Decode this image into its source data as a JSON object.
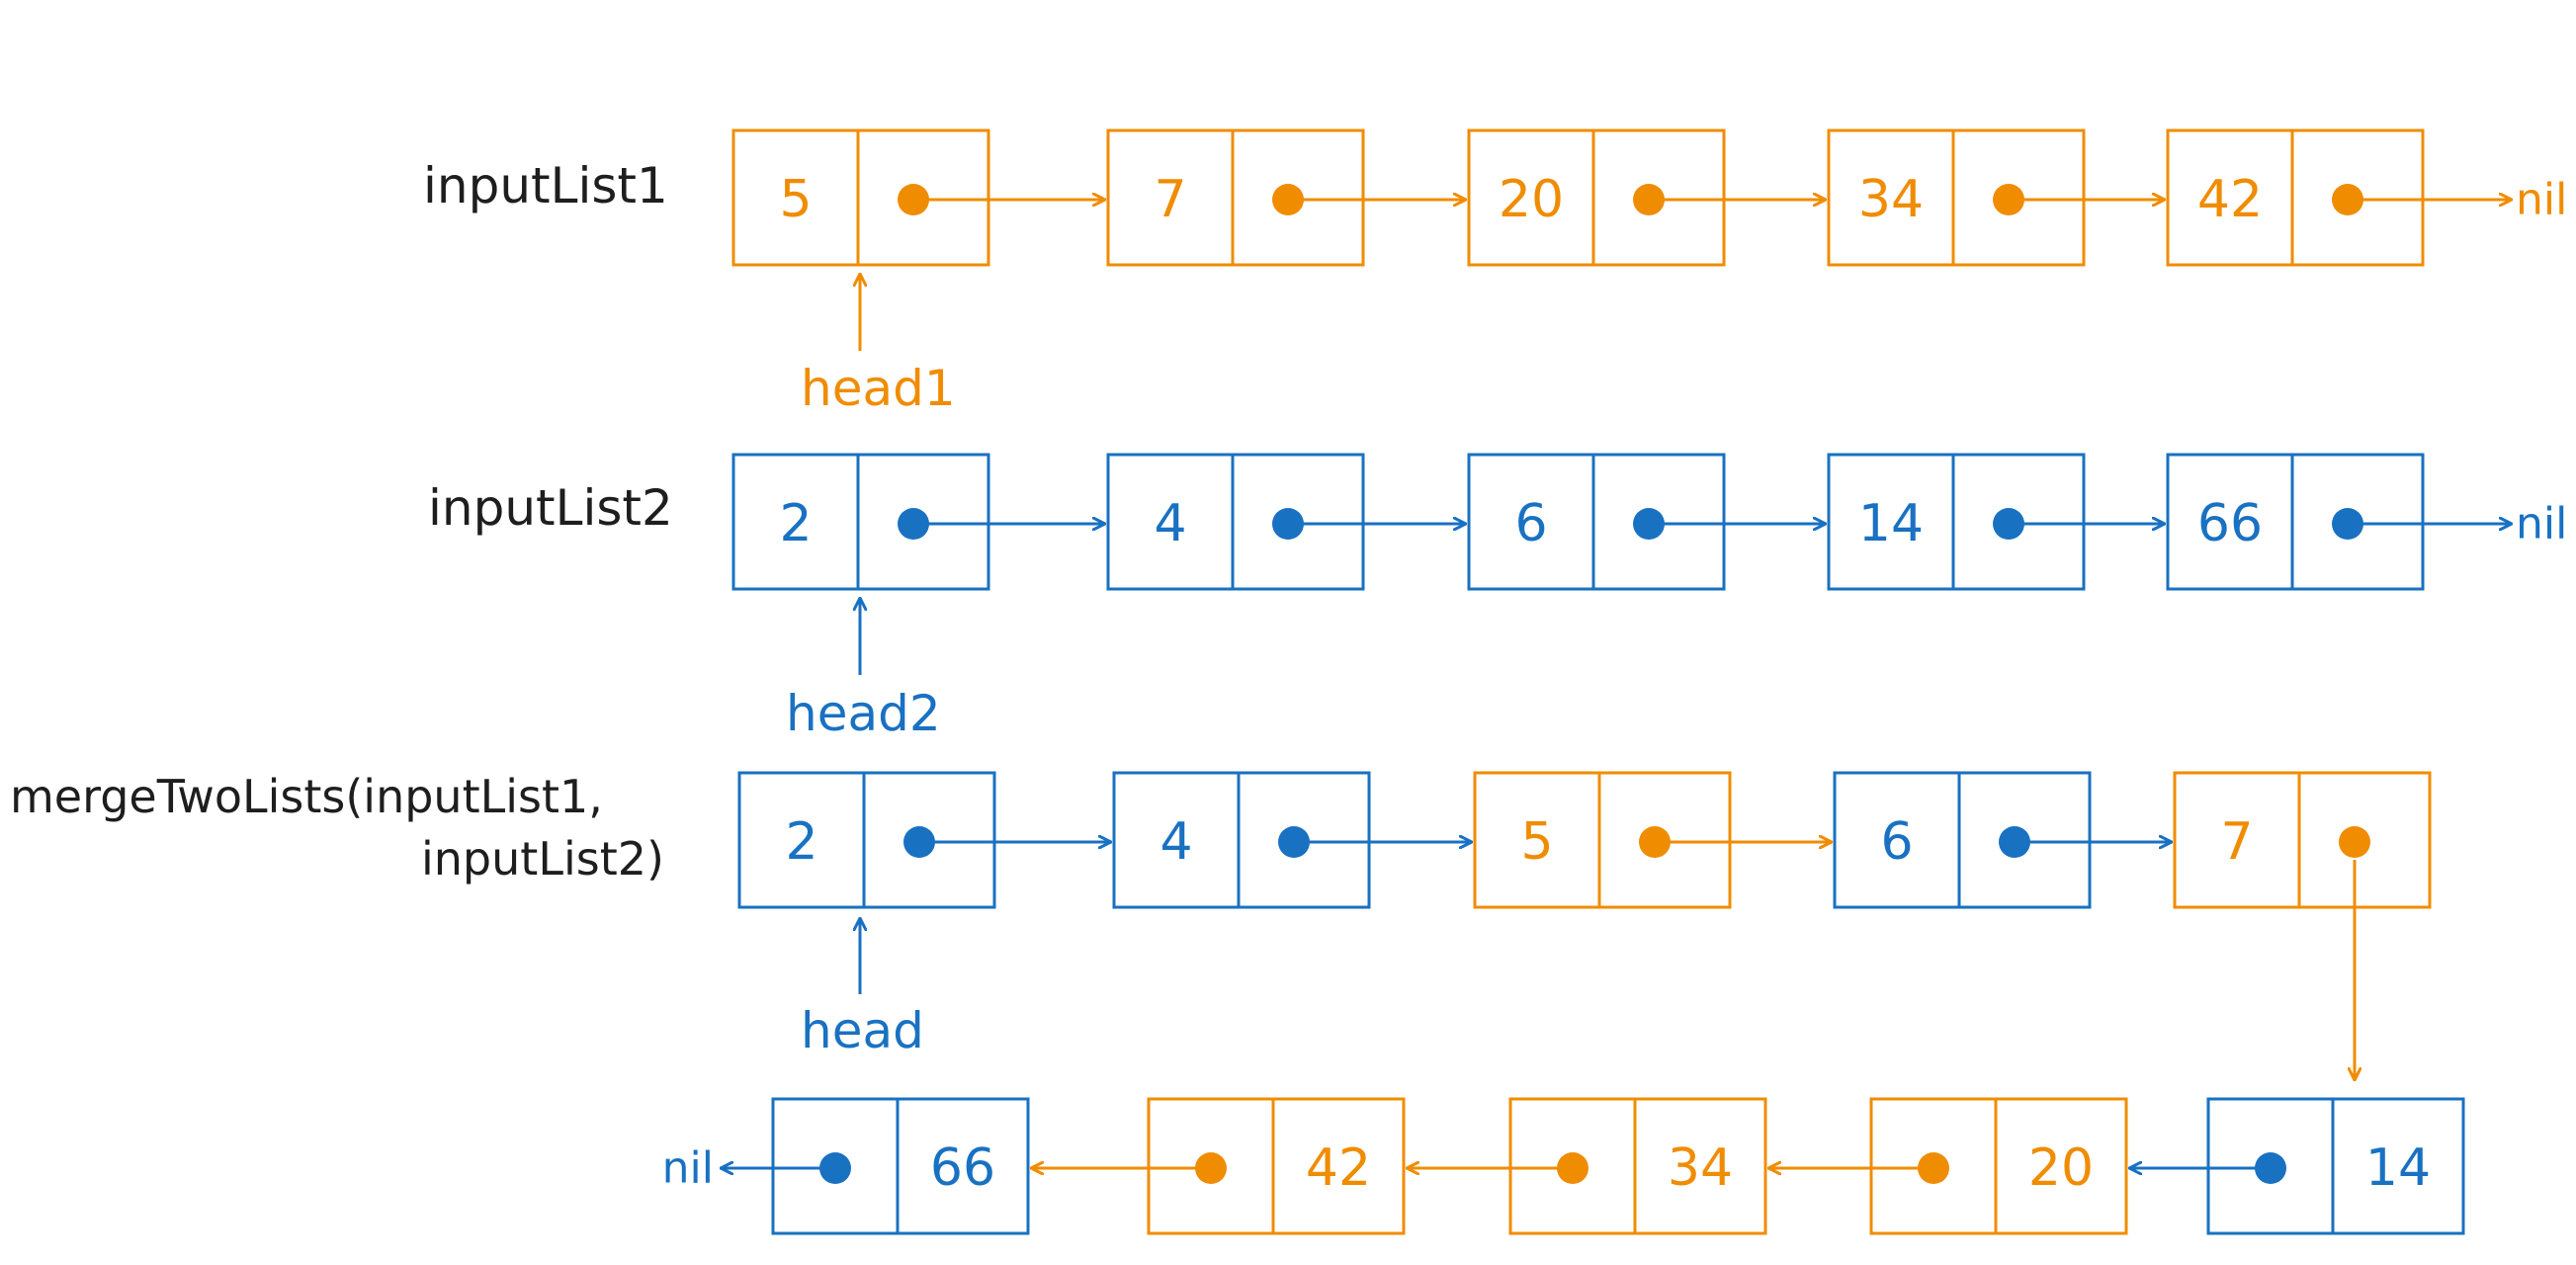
{
  "colors": {
    "orange": "#f08c00",
    "blue": "#1971c2",
    "black": "#1e1e1e"
  },
  "labels": {
    "row1": "inputList1",
    "row2": "inputList2",
    "row3_line1": "mergeTwoLists(inputList1,",
    "row3_line2": "inputList2)"
  },
  "pointers": {
    "head1": "head1",
    "head2": "head2",
    "head": "head"
  },
  "nil_text": "nil",
  "lists": {
    "input1": {
      "values": [
        "5",
        "7",
        "20",
        "34",
        "42"
      ],
      "color": "orange"
    },
    "input2": {
      "values": [
        "2",
        "4",
        "6",
        "14",
        "66"
      ],
      "color": "blue"
    },
    "merged": {
      "values": [
        "2",
        "4",
        "5",
        "6",
        "7",
        "14",
        "20",
        "34",
        "42",
        "66"
      ],
      "colors": [
        "blue",
        "blue",
        "orange",
        "blue",
        "orange",
        "blue",
        "orange",
        "orange",
        "orange",
        "blue"
      ]
    }
  }
}
